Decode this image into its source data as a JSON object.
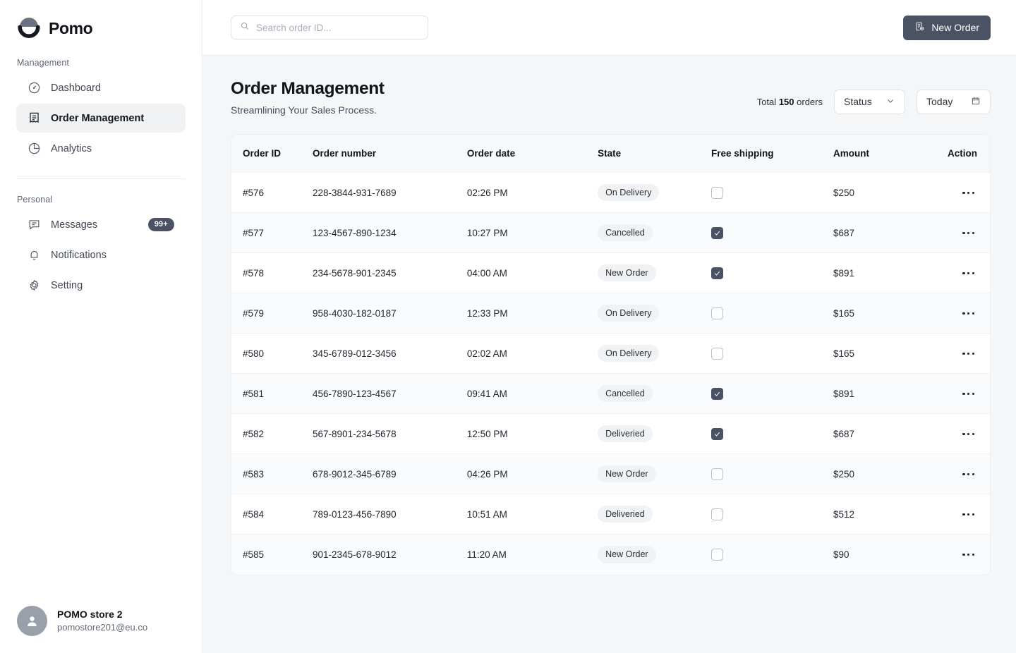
{
  "brand": {
    "name": "Pomo",
    "logo_icon": "pomo-logo-mark"
  },
  "sidebar": {
    "sections": [
      {
        "label": "Management",
        "items": [
          {
            "label": "Dashboard",
            "icon": "gauge-icon",
            "active": false
          },
          {
            "label": "Order Management",
            "icon": "receipt-icon",
            "active": true
          },
          {
            "label": "Analytics",
            "icon": "pie-chart-icon",
            "active": false
          }
        ]
      },
      {
        "label": "Personal",
        "items": [
          {
            "label": "Messages",
            "icon": "message-icon",
            "active": false,
            "badge": "99+"
          },
          {
            "label": "Notifications",
            "icon": "bell-icon",
            "active": false
          },
          {
            "label": "Setting",
            "icon": "gear-icon",
            "active": false
          }
        ]
      }
    ],
    "profile": {
      "name": "POMO store 2",
      "email": "pomostore201@eu.co",
      "avatar_icon": "user-icon"
    }
  },
  "topbar": {
    "search_placeholder": "Search order ID...",
    "search_value": "",
    "search_icon": "search-icon",
    "new_order_label": "New Order",
    "new_order_icon": "new-order-icon"
  },
  "page": {
    "title": "Order Management",
    "subtitle": "Streamlining Your Sales Process.",
    "total_prefix": "Total",
    "total_count": "150",
    "total_suffix": "orders",
    "status_filter": "Status",
    "status_icon": "chevron-down-icon",
    "date_filter": "Today",
    "date_icon": "calendar-icon"
  },
  "table": {
    "columns": [
      "Order ID",
      "Order number",
      "Order date",
      "State",
      "Free shipping",
      "Amount",
      "Action"
    ],
    "action_icon": "more-horizontal-icon",
    "rows": [
      {
        "id": "#576",
        "number": "228-3844-931-7689",
        "date": "02:26 PM",
        "state": "On Delivery",
        "shipping": false,
        "amount": "$250"
      },
      {
        "id": "#577",
        "number": "123-4567-890-1234",
        "date": "10:27 PM",
        "state": "Cancelled",
        "shipping": true,
        "amount": "$687"
      },
      {
        "id": "#578",
        "number": "234-5678-901-2345",
        "date": "04:00 AM",
        "state": "New Order",
        "shipping": true,
        "amount": "$891"
      },
      {
        "id": "#579",
        "number": "958-4030-182-0187",
        "date": "12:33 PM",
        "state": "On Delivery",
        "shipping": false,
        "amount": "$165"
      },
      {
        "id": "#580",
        "number": "345-6789-012-3456",
        "date": "02:02 AM",
        "state": "On Delivery",
        "shipping": false,
        "amount": "$165"
      },
      {
        "id": "#581",
        "number": "456-7890-123-4567",
        "date": "09:41 AM",
        "state": "Cancelled",
        "shipping": true,
        "amount": "$891"
      },
      {
        "id": "#582",
        "number": "567-8901-234-5678",
        "date": "12:50 PM",
        "state": "Deliveried",
        "shipping": true,
        "amount": "$687"
      },
      {
        "id": "#583",
        "number": "678-9012-345-6789",
        "date": "04:26 PM",
        "state": "New Order",
        "shipping": false,
        "amount": "$250"
      },
      {
        "id": "#584",
        "number": "789-0123-456-7890",
        "date": "10:51 AM",
        "state": "Deliveried",
        "shipping": false,
        "amount": "$512"
      },
      {
        "id": "#585",
        "number": "901-2345-678-9012",
        "date": "11:20 AM",
        "state": "New Order",
        "shipping": false,
        "amount": "$90"
      }
    ]
  },
  "colors": {
    "accent": "#4a5264",
    "text": "#111418",
    "muted": "#636a76",
    "page_bg": "#f4f6f8",
    "pill_bg": "#f1f2f4"
  }
}
